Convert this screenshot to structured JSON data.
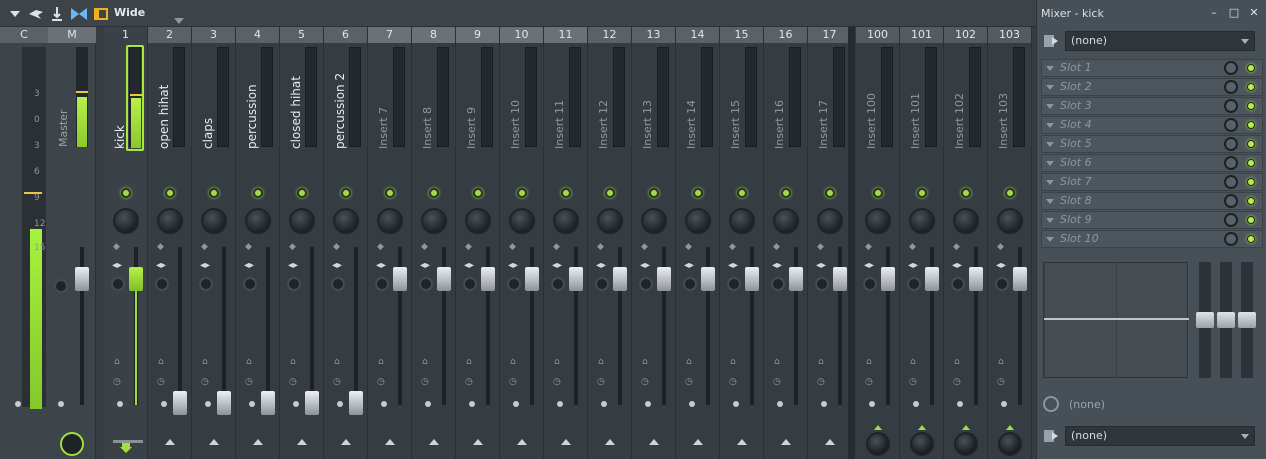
{
  "toolbar": {
    "wide_label": "Wide"
  },
  "panel": {
    "title": "Mixer - kick",
    "input_select": "(none)",
    "output_select": "(none)",
    "sidechain_label": "(none)",
    "slots": [
      "Slot 1",
      "Slot 2",
      "Slot 3",
      "Slot 4",
      "Slot 5",
      "Slot 6",
      "Slot 7",
      "Slot 8",
      "Slot 9",
      "Slot 10"
    ]
  },
  "master": {
    "header_c": "C",
    "header_m": "M",
    "name": "Master",
    "scale": [
      "3",
      "0",
      "3",
      "6",
      "9",
      "12",
      "15"
    ]
  },
  "tracks": [
    {
      "num": "1",
      "name": "kick"
    },
    {
      "num": "2",
      "name": "open hihat"
    },
    {
      "num": "3",
      "name": "claps"
    },
    {
      "num": "4",
      "name": "percussion"
    },
    {
      "num": "5",
      "name": "closed hihat"
    },
    {
      "num": "6",
      "name": "percussion 2"
    },
    {
      "num": "7",
      "name": "Insert 7"
    },
    {
      "num": "8",
      "name": "Insert 8"
    },
    {
      "num": "9",
      "name": "Insert 9"
    },
    {
      "num": "10",
      "name": "Insert 10"
    },
    {
      "num": "11",
      "name": "Insert 11"
    },
    {
      "num": "12",
      "name": "Insert 12"
    },
    {
      "num": "13",
      "name": "Insert 13"
    },
    {
      "num": "14",
      "name": "Insert 14"
    },
    {
      "num": "15",
      "name": "Insert 15"
    },
    {
      "num": "16",
      "name": "Insert 16"
    },
    {
      "num": "17",
      "name": "Insert 17"
    },
    {
      "num": "100",
      "name": "Insert 100"
    },
    {
      "num": "101",
      "name": "Insert 101"
    },
    {
      "num": "102",
      "name": "Insert 102"
    },
    {
      "num": "103",
      "name": "Insert 103"
    }
  ],
  "colors": {
    "accent": "#9fe03c",
    "background": "#353c42"
  }
}
